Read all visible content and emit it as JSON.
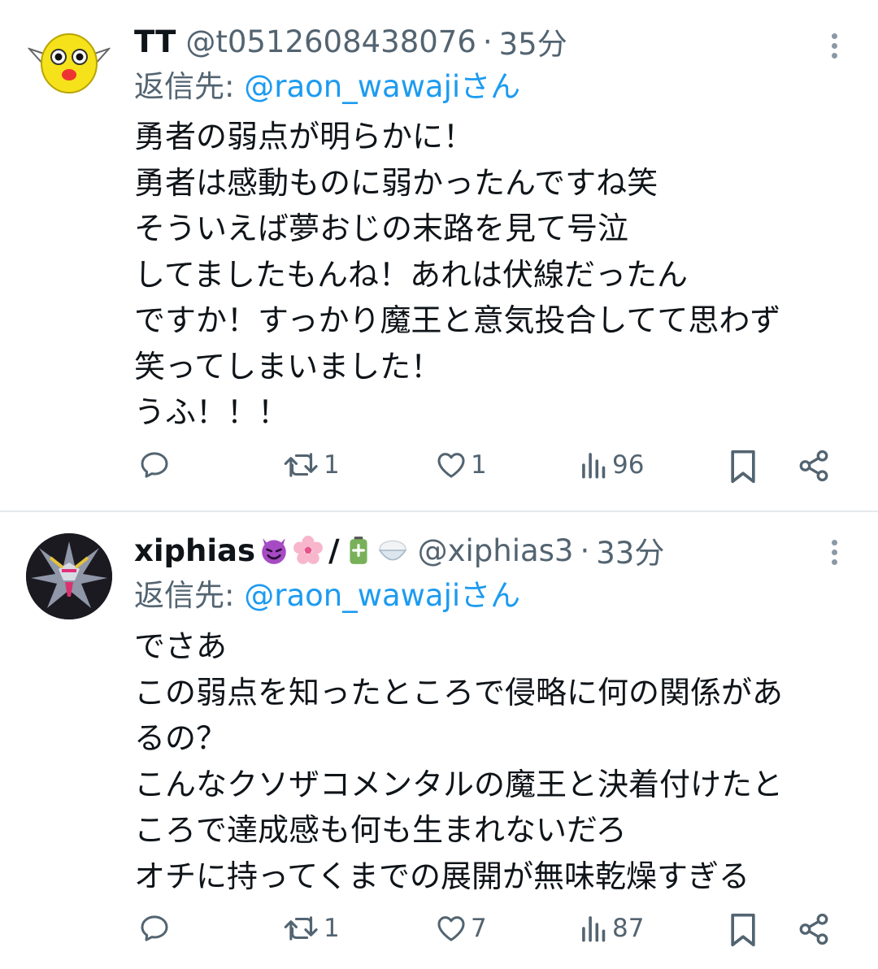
{
  "tweets": [
    {
      "name": "TT",
      "handle": "@t0512608438076",
      "sep": "·",
      "time": "35分",
      "reply_prefix": "返信先: ",
      "reply_to": "@raon_wawaji",
      "reply_suffix": "さん",
      "body": "勇者の弱点が明らかに！\n勇者は感動ものに弱かったんですね笑\nそういえば夢おじの末路を見て号泣\nしてましたもんね！あれは伏線だったん\nですか！すっかり魔王と意気投合してて思わず\n笑ってしまいました！\nうふ！！！",
      "retweets": "1",
      "likes": "1",
      "views": "96"
    },
    {
      "name": "xiphias",
      "name_emojis": [
        "devil-emoji",
        "cherry-blossom-emoji"
      ],
      "name_slash": "/",
      "name_emojis2": [
        "battery-emoji",
        "rice-emoji"
      ],
      "handle": "@xiphias3",
      "sep": "·",
      "time": "33分",
      "reply_prefix": "返信先: ",
      "reply_to": "@raon_wawaji",
      "reply_suffix": "さん",
      "body": "でさあ\nこの弱点を知ったところで侵略に何の関係があ\nるの？\nこんなクソザコメンタルの魔王と決着付けたと\nころで達成感も何も生まれないだろ\nオチに持ってくまでの展開が無味乾燥すぎる",
      "retweets": "1",
      "likes": "7",
      "views": "87"
    }
  ],
  "colors": {
    "link": "#1d9bf0",
    "muted": "#536471",
    "text": "#0f1419"
  }
}
